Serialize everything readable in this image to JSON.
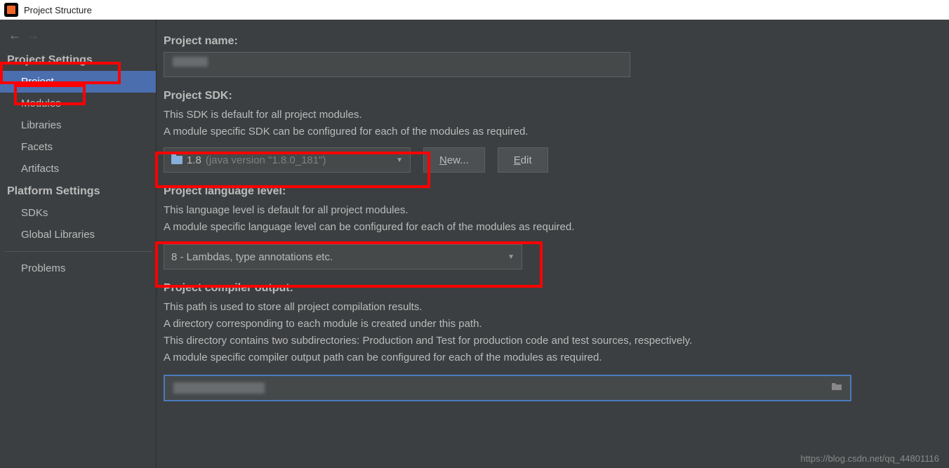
{
  "title": "Project Structure",
  "sidebar": {
    "project_settings_header": "Project Settings",
    "platform_settings_header": "Platform Settings",
    "items_project": [
      "Project",
      "Modules",
      "Libraries",
      "Facets",
      "Artifacts"
    ],
    "items_platform": [
      "SDKs",
      "Global Libraries"
    ],
    "problems": "Problems"
  },
  "project_name": {
    "label": "Project name:",
    "value": ""
  },
  "project_sdk": {
    "label": "Project SDK:",
    "desc1": "This SDK is default for all project modules.",
    "desc2": "A module specific SDK can be configured for each of the modules as required.",
    "selected": "1.8",
    "selected_detail": "(java version \"1.8.0_181\")",
    "new_btn": "New...",
    "edit_btn": "Edit"
  },
  "language_level": {
    "label": "Project language level:",
    "desc1": "This language level is default for all project modules.",
    "desc2": "A module specific language level can be configured for each of the modules as required.",
    "selected": "8 - Lambdas, type annotations etc."
  },
  "compiler_output": {
    "label": "Project compiler output:",
    "desc1": "This path is used to store all project compilation results.",
    "desc2": "A directory corresponding to each module is created under this path.",
    "desc3": "This directory contains two subdirectories: Production and Test for production code and test sources, respectively.",
    "desc4": "A module specific compiler output path can be configured for each of the modules as required.",
    "value": ""
  },
  "watermark": "https://blog.csdn.net/qq_44801116"
}
